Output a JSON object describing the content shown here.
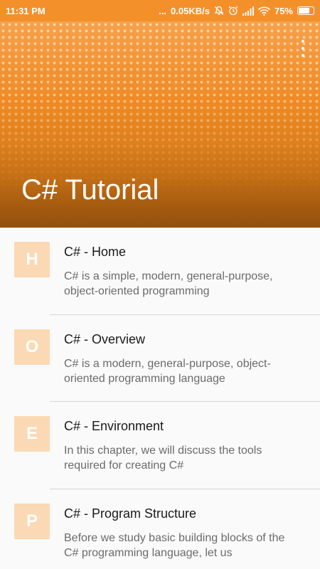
{
  "status_bar": {
    "time": "11:31 PM",
    "signal_dots": "...",
    "network_speed": "0.05KB/s",
    "battery_percent": "75%",
    "battery_level": 0.75,
    "icons": [
      "mute-bell-icon",
      "alarm-icon",
      "signal-bars-icon",
      "wifi-icon",
      "battery-icon"
    ]
  },
  "header": {
    "title": "C# Tutorial",
    "menu_icon": "overflow-menu-icon",
    "colors": {
      "top": "#f7a14a",
      "mid": "#ee8a23",
      "bottom": "#a85d10"
    }
  },
  "items": [
    {
      "letter": "H",
      "title": "C# - Home",
      "description": "C# is a simple, modern, general-purpose, object-oriented programming"
    },
    {
      "letter": "O",
      "title": "C# - Overview",
      "description": "C# is a modern, general-purpose, object-oriented programming language"
    },
    {
      "letter": "E",
      "title": "C# - Environment",
      "description": "In this chapter, we will discuss the tools required for creating C#"
    },
    {
      "letter": "P",
      "title": "C# - Program Structure",
      "description": "Before we study basic building blocks of the C# programming language, let us"
    }
  ],
  "colors": {
    "status_bar": "#f4902a",
    "avatar_bg": "#fbd9b4",
    "title_text": "#1a1a1a",
    "description_text": "#6b6b6b",
    "divider": "#d6d6d6"
  }
}
